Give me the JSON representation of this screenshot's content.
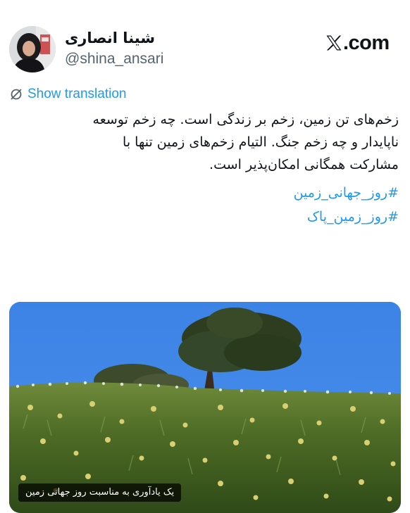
{
  "user": {
    "display_name": "شینا انصاری",
    "handle": "@shina_ansari"
  },
  "brand": {
    "logo_icon": "x-logo-icon",
    "site_text": ".com"
  },
  "translation": {
    "icon": "translate-icon",
    "label": "Show translation"
  },
  "tweet": {
    "lines": [
      "زخم‌های تن زمین، زخم بر زندگی است. چه زخم توسعه",
      "ناپایدار و چه زخم جنگ. التیام زخم‌های زمین تنها با",
      "مشارکت همگانی امکان‌پذیر است."
    ],
    "hashtags": [
      "#روز_جهانی_زمین",
      "#روز_زمین_پاک"
    ]
  },
  "media": {
    "description_icon": "landscape-photo",
    "caption": "یک یادآوری به مناسبت روز جهانی زمین"
  },
  "colors": {
    "link": "#1d9bf0",
    "text": "#0f1419",
    "secondary_text": "#536471"
  }
}
